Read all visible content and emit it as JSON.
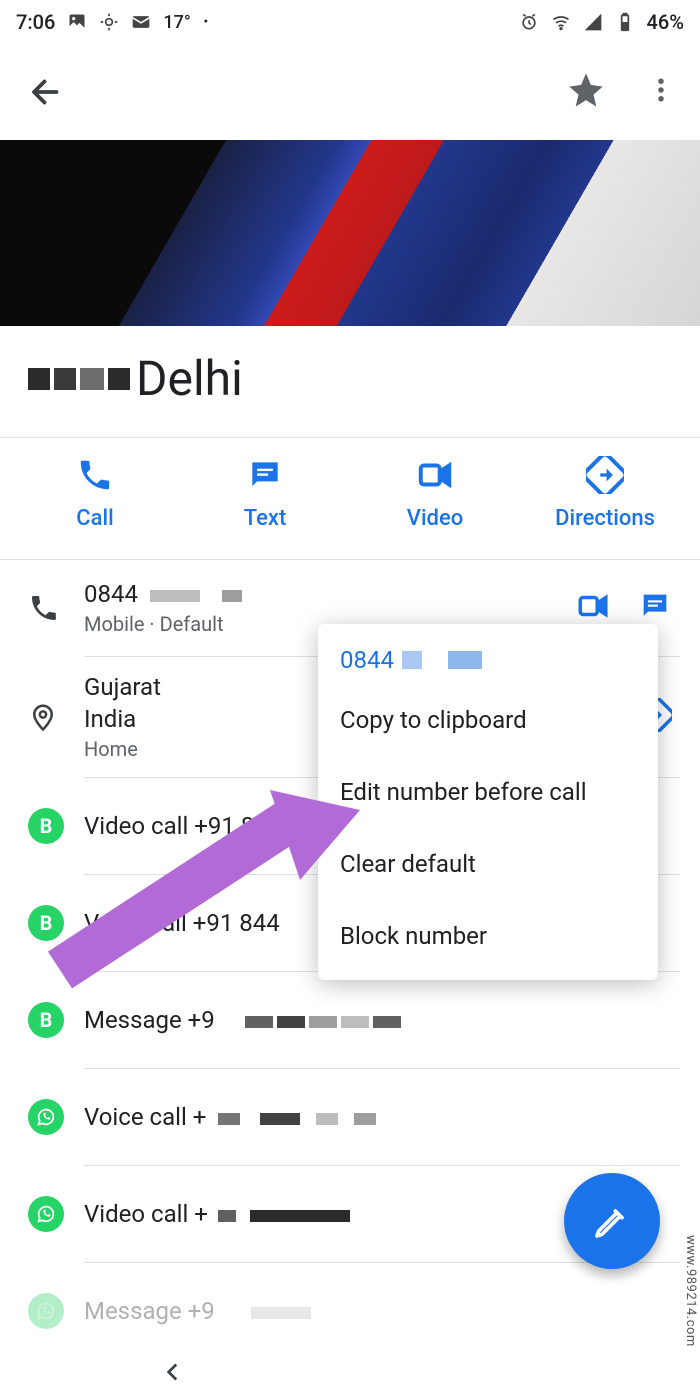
{
  "status": {
    "time": "7:06",
    "temp": "17°",
    "battery": "46%"
  },
  "contact": {
    "name_suffix": "Delhi"
  },
  "actions": {
    "call": "Call",
    "text": "Text",
    "video": "Video",
    "directions": "Directions"
  },
  "phone": {
    "number": "0844",
    "type": "Mobile · Default"
  },
  "address": {
    "line1": "Gujarat",
    "line2": "India",
    "type": "Home"
  },
  "items": {
    "vc1": "Video call +91 844",
    "voice1": "Voice call +91 844",
    "msg1": "Message +9",
    "voice2": "Voice call +",
    "vc2": "Video call +",
    "msg2": "Message +9"
  },
  "menu": {
    "header": "0844",
    "copy": "Copy to clipboard",
    "edit": "Edit number before call",
    "clear": "Clear default",
    "block": "Block number"
  },
  "watermark": "www.989214.com"
}
